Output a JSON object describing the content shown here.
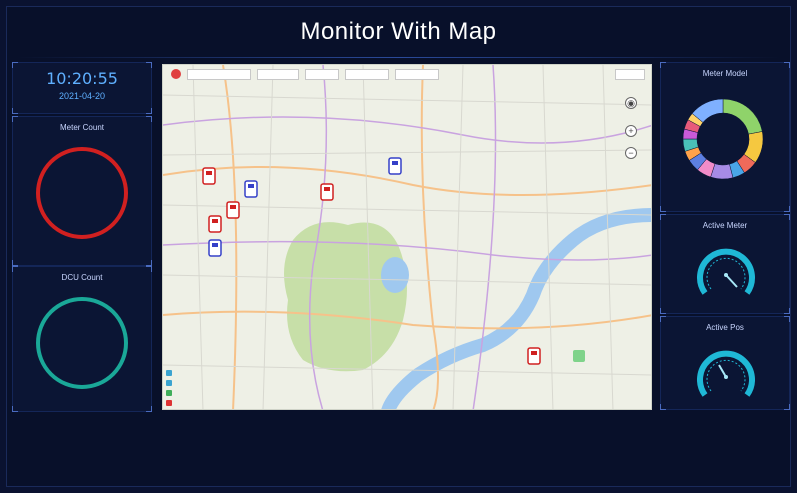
{
  "header": {
    "title": "Monitor With Map"
  },
  "clock": {
    "time": "10:20:55",
    "date": "2021-04-20"
  },
  "meter_count": {
    "title": "Meter Count",
    "value": ""
  },
  "dcu_count": {
    "title": "DCU Count",
    "value": ""
  },
  "meter_model": {
    "title": "Meter Model"
  },
  "active_meter": {
    "title": "Active Meter",
    "value": ""
  },
  "active_pos": {
    "title": "Active Pos",
    "value": ""
  },
  "colors": {
    "background": "#0a1230",
    "meter_ring": "#d12020",
    "dcu_ring": "#1aa898",
    "gauge": "#1fb8d6",
    "clock": "#5fb0ff"
  },
  "meter_model_chart": {
    "type": "pie",
    "segments": [
      {
        "value": 22,
        "color": "#8fd36a"
      },
      {
        "value": 13,
        "color": "#f5c840"
      },
      {
        "value": 6,
        "color": "#ef6a5a"
      },
      {
        "value": 5,
        "color": "#4aa6e8"
      },
      {
        "value": 9,
        "color": "#a78be6"
      },
      {
        "value": 6,
        "color": "#f28cc8"
      },
      {
        "value": 5,
        "color": "#5d7fe0"
      },
      {
        "value": 4,
        "color": "#ffa24a"
      },
      {
        "value": 5,
        "color": "#4ac0b8"
      },
      {
        "value": 4,
        "color": "#c95ad8"
      },
      {
        "value": 4,
        "color": "#e85a7a"
      },
      {
        "value": 3,
        "color": "#ffd36a"
      },
      {
        "value": 14,
        "color": "#7fb0ff"
      }
    ]
  }
}
